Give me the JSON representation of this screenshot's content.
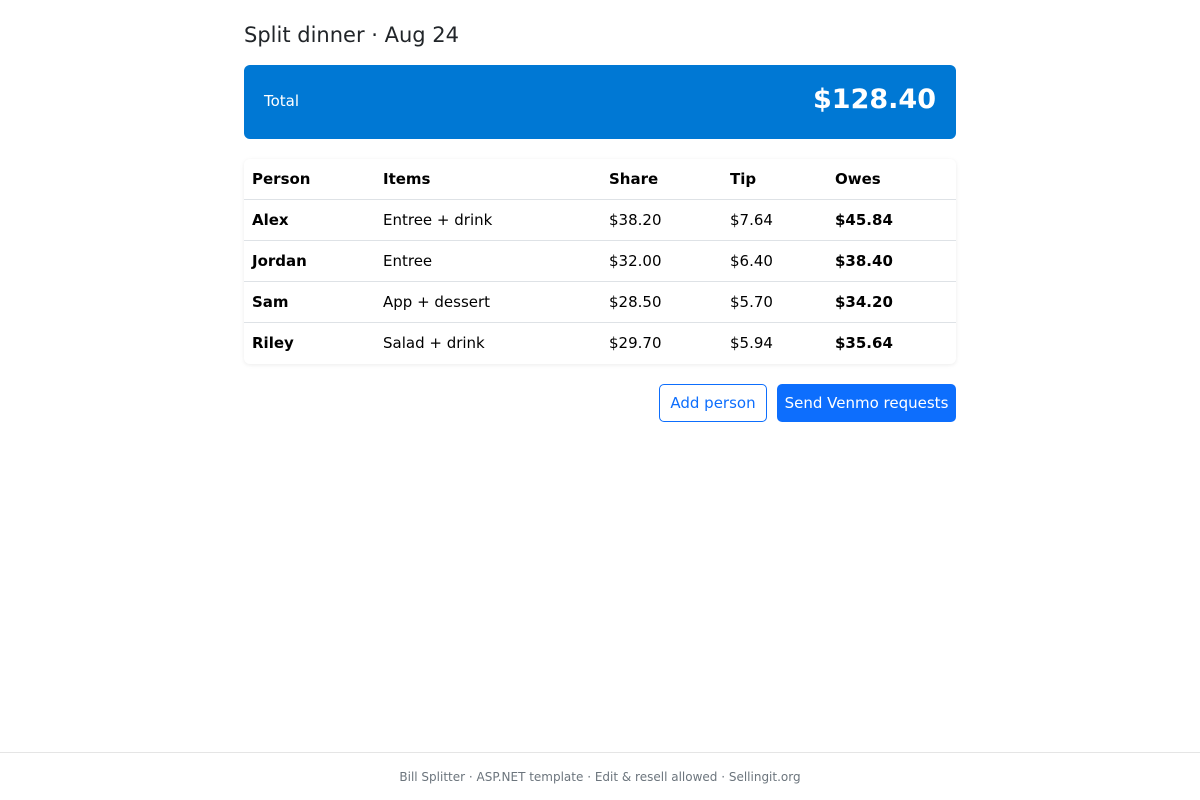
{
  "header": {
    "title": "Split dinner · Aug 24"
  },
  "total": {
    "label": "Total",
    "amount": "$128.40"
  },
  "table": {
    "columns": [
      "Person",
      "Items",
      "Share",
      "Tip",
      "Owes"
    ],
    "rows": [
      {
        "person": "Alex",
        "items": "Entree + drink",
        "share": "$38.20",
        "tip": "$7.64",
        "owes": "$45.84"
      },
      {
        "person": "Jordan",
        "items": "Entree",
        "share": "$32.00",
        "tip": "$6.40",
        "owes": "$38.40"
      },
      {
        "person": "Sam",
        "items": "App + dessert",
        "share": "$28.50",
        "tip": "$5.70",
        "owes": "$34.20"
      },
      {
        "person": "Riley",
        "items": "Salad + drink",
        "share": "$29.70",
        "tip": "$5.94",
        "owes": "$35.64"
      }
    ]
  },
  "actions": {
    "add_person": "Add person",
    "send_requests": "Send Venmo requests"
  },
  "footer": {
    "text": "Bill Splitter · ASP.NET template · Edit & resell allowed · Sellingit.org"
  },
  "colors": {
    "total_card": "#0078d4",
    "primary": "#0d6efd"
  }
}
